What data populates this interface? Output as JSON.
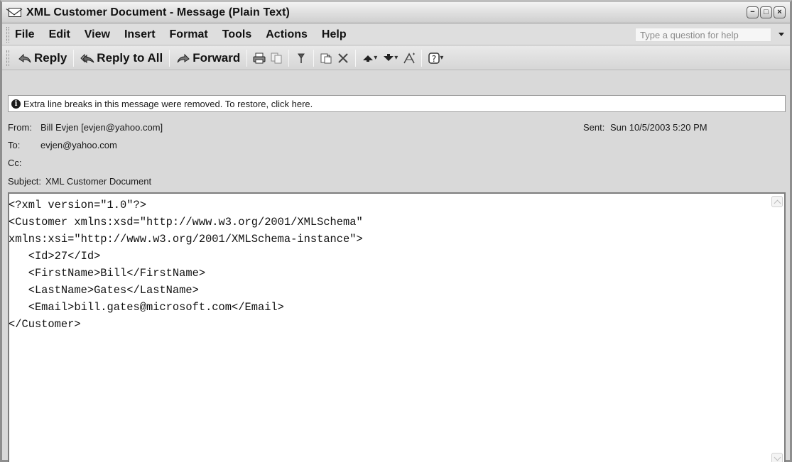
{
  "window": {
    "title": "XML Customer Document - Message (Plain Text)",
    "minimize_label": "−",
    "maximize_label": "□",
    "close_label": "×"
  },
  "menu": {
    "items": [
      "File",
      "Edit",
      "View",
      "Insert",
      "Format",
      "Tools",
      "Actions",
      "Help"
    ],
    "help_placeholder": "Type a question for help"
  },
  "toolbar": {
    "reply_label": "Reply",
    "reply_all_label": "Reply to All",
    "forward_label": "Forward",
    "icons": [
      "reply-icon",
      "reply-all-icon",
      "forward-icon",
      "print-icon",
      "copy-icon",
      "flag-icon",
      "move-to-folder-icon",
      "delete-icon",
      "previous-item-icon",
      "next-item-icon",
      "address-book-icon",
      "help-icon"
    ]
  },
  "infobar": {
    "text": "Extra line breaks in this message were removed. To restore, click here."
  },
  "headers": {
    "from_label": "From:",
    "from_value": "Bill Evjen [evjen@yahoo.com]",
    "to_label": "To:",
    "to_value": "evjen@yahoo.com",
    "cc_label": "Cc:",
    "cc_value": "",
    "subject_label": "Subject:",
    "subject_value": "XML Customer Document",
    "sent_label": "Sent:",
    "sent_value": "Sun 10/5/2003 5:20 PM"
  },
  "body": {
    "lines": [
      "<?xml version=\"1.0\"?>",
      "<Customer xmlns:xsd=\"http://www.w3.org/2001/XMLSchema\"",
      "xmlns:xsi=\"http://www.w3.org/2001/XMLSchema-instance\">",
      "   <Id>27</Id>",
      "   <FirstName>Bill</FirstName>",
      "   <LastName>Gates</LastName>",
      "   <Email>bill.gates@microsoft.com</Email>",
      "</Customer>"
    ]
  }
}
